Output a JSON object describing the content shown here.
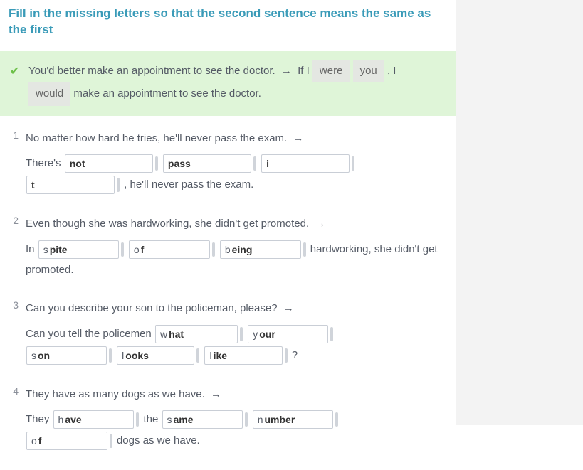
{
  "instructions": "Fill in the missing letters so that the second sentence means the same as the first",
  "example": {
    "text_a": "You'd better make an appointment to see the doctor.",
    "arrow": "→",
    "text_b1": "If I",
    "fill1": "were",
    "fill2": "you",
    "text_b2": ", I",
    "fill3": "would",
    "text_b3": "make an appointment to see the doctor."
  },
  "questions": [
    {
      "num": "1",
      "prompt": "No matter how hard he tries, he'll never pass the exam.",
      "arrow": "→",
      "line2_a": "There's",
      "blanks_row1": [
        {
          "hint": "",
          "value": "not",
          "w": "w110"
        },
        {
          "hint": "",
          "value": "pass",
          "w": "w110"
        },
        {
          "hint": "",
          "value": "i",
          "w": "w110"
        }
      ],
      "blanks_row2": [
        {
          "hint": "",
          "value": "t",
          "w": "w110"
        }
      ],
      "line2_b": ", he'll never pass the exam."
    },
    {
      "num": "2",
      "prompt": "Even though she was hardworking, she didn't get promoted.",
      "arrow": "→",
      "line2_a": "In",
      "blanks_row1": [
        {
          "hint": "s",
          "value": "pite",
          "w": "w90"
        },
        {
          "hint": "o",
          "value": "f",
          "w": "w90"
        },
        {
          "hint": "b",
          "value": "eing",
          "w": "w90"
        }
      ],
      "line2_b": "hardworking, she didn't get promoted."
    },
    {
      "num": "3",
      "prompt": "Can you describe your son to the policeman, please?",
      "arrow": "→",
      "line2_a": "Can you tell the policemen",
      "blanks_row1": [
        {
          "hint": "w",
          "value": "hat",
          "w": "w90"
        },
        {
          "hint": "y",
          "value": "our",
          "w": "w90"
        }
      ],
      "blanks_row2": [
        {
          "hint": "s",
          "value": "on",
          "w": "w90"
        },
        {
          "hint": "l",
          "value": "ooks",
          "w": "w90"
        },
        {
          "hint": "l",
          "value": "ike",
          "w": "w90"
        }
      ],
      "line2_b": "?"
    },
    {
      "num": "4",
      "prompt": "They have as many dogs as we have.",
      "arrow": "→",
      "line2_a": "They",
      "blanks_row1": [
        {
          "hint": "h",
          "value": "ave",
          "w": "w90"
        },
        {
          "hint_plain": "the",
          "hint": "s",
          "value": "ame",
          "w": "w90"
        },
        {
          "hint": "n",
          "value": "umber",
          "w": "w90"
        }
      ],
      "blanks_row2": [
        {
          "hint": "o",
          "value": "f",
          "w": "w90"
        }
      ],
      "line2_b": "dogs as we have."
    }
  ]
}
